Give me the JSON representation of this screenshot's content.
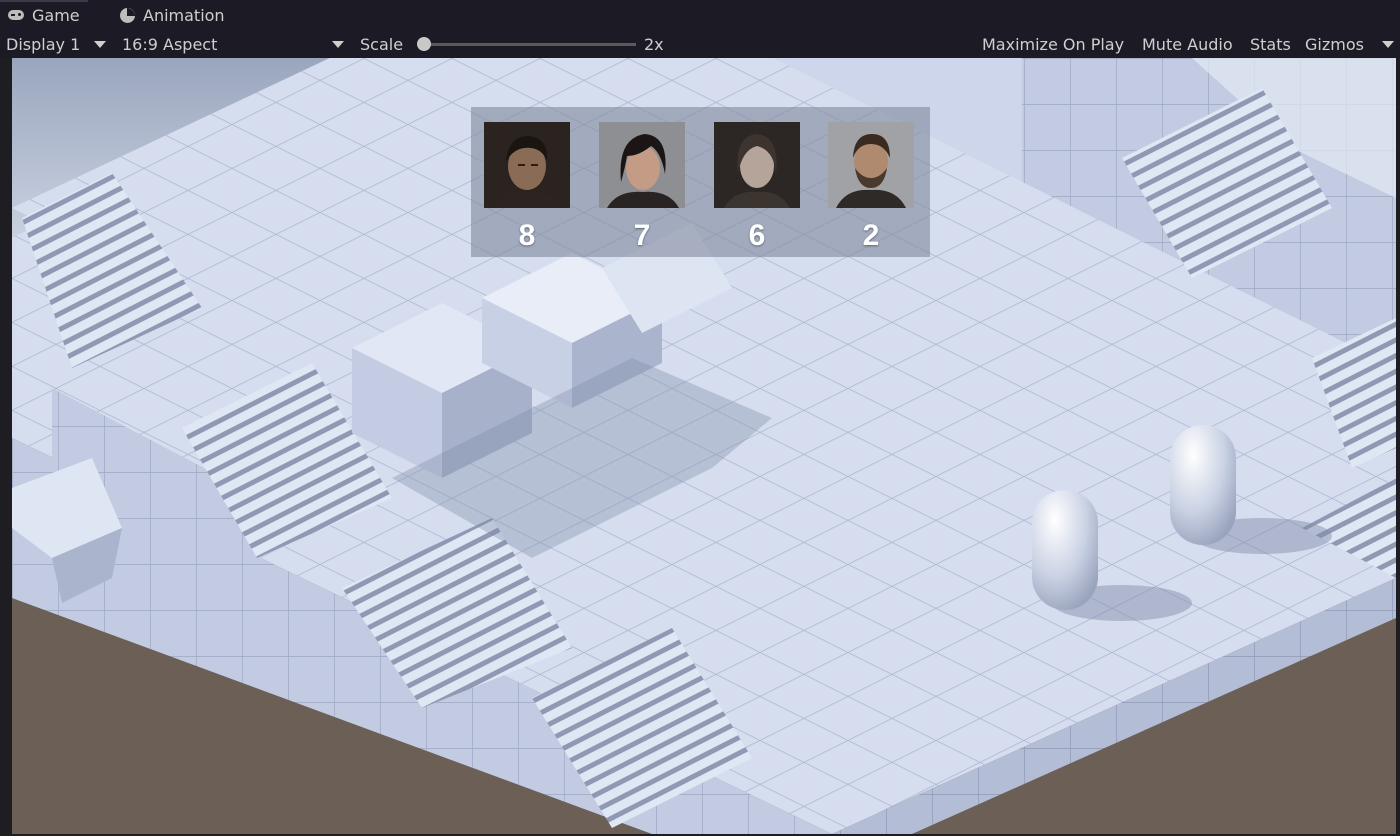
{
  "tabs": [
    {
      "label": "Game",
      "icon": "gamepad-icon",
      "active": true
    },
    {
      "label": "Animation",
      "icon": "animation-clock-icon",
      "active": false
    }
  ],
  "toolbar": {
    "display": "Display 1",
    "aspect": "16:9 Aspect",
    "scale_label": "Scale",
    "scale_value": "2x",
    "scale_fraction": 0.0,
    "maximize": "Maximize On Play",
    "mute": "Mute Audio",
    "stats": "Stats",
    "gizmos": "Gizmos"
  },
  "hud": {
    "characters": [
      {
        "count": "8",
        "portrait": "dark-haired-man-portrait"
      },
      {
        "count": "7",
        "portrait": "woman-with-bangs-portrait"
      },
      {
        "count": "6",
        "portrait": "pale-woman-portrait"
      },
      {
        "count": "2",
        "portrait": "bearded-man-portrait"
      }
    ]
  },
  "colors": {
    "editor_bg": "#1c1a24",
    "tile_light": "#d4dcef",
    "tile_side": "#b9c3dc",
    "ground": "#6b5f56",
    "hud_bg": "#78829688"
  }
}
